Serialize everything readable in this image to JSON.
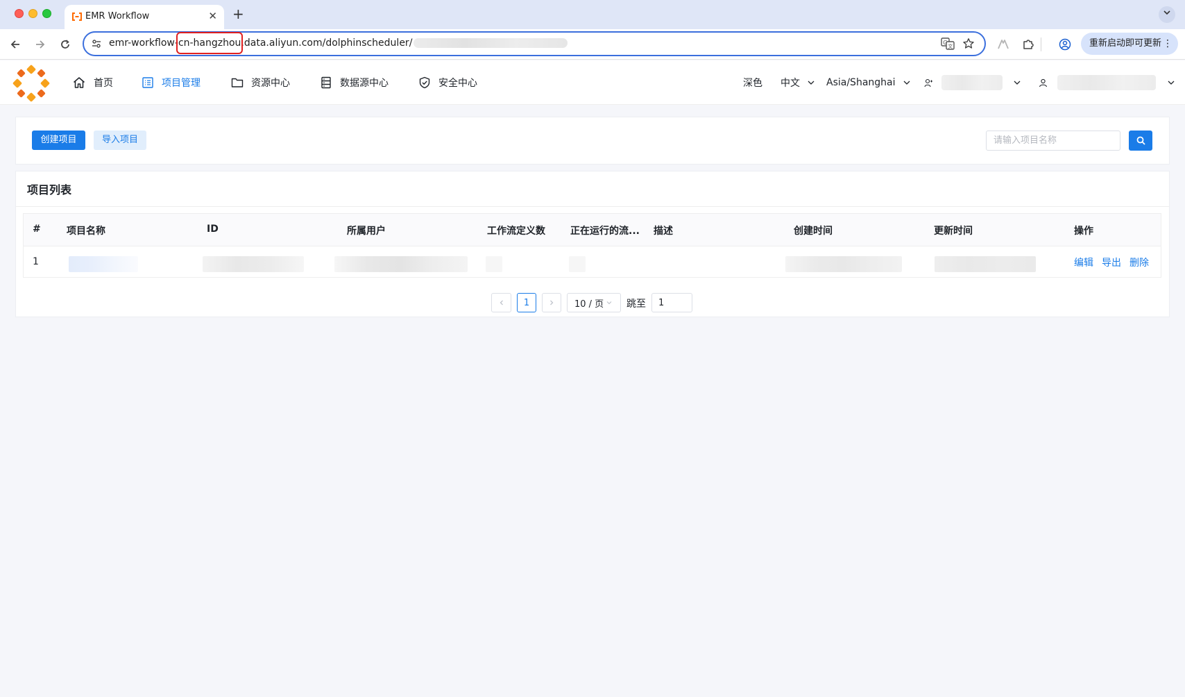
{
  "browser": {
    "tab_title": "EMR Workflow",
    "tab_close": "✕",
    "new_tab": "+",
    "url_prefix": "emr-workflow-",
    "url_highlight": "cn-hangzhou",
    "url_suffix": ".data.aliyun.com/dolphinscheduler/",
    "update_label": "重新启动即可更新"
  },
  "header": {
    "menu": [
      {
        "label": "首页",
        "icon": "home-icon"
      },
      {
        "label": "项目管理",
        "icon": "project-list-icon",
        "active": true
      },
      {
        "label": "资源中心",
        "icon": "folder-icon"
      },
      {
        "label": "数据源中心",
        "icon": "database-icon"
      },
      {
        "label": "安全中心",
        "icon": "shield-check-icon"
      }
    ],
    "theme": "深色",
    "language": "中文",
    "timezone": "Asia/Shanghai"
  },
  "toolbar": {
    "create_label": "创建项目",
    "import_label": "导入项目",
    "search_placeholder": "请输入项目名称"
  },
  "projects": {
    "title": "项目列表",
    "columns": [
      "#",
      "项目名称",
      "ID",
      "所属用户",
      "工作流定义数",
      "正在运行的流...",
      "描述",
      "创建时间",
      "更新时间",
      "操作"
    ],
    "rows": [
      {
        "index": "1",
        "actions": [
          "编辑",
          "导出",
          "删除"
        ]
      }
    ]
  },
  "pagination": {
    "current": "1",
    "page_size": "10 / 页",
    "jump_label": "跳至",
    "jump_value": "1"
  },
  "colors": {
    "accent": "#1a7ce8",
    "accent_light": "#e1eefc",
    "highlight": "#e02020"
  }
}
